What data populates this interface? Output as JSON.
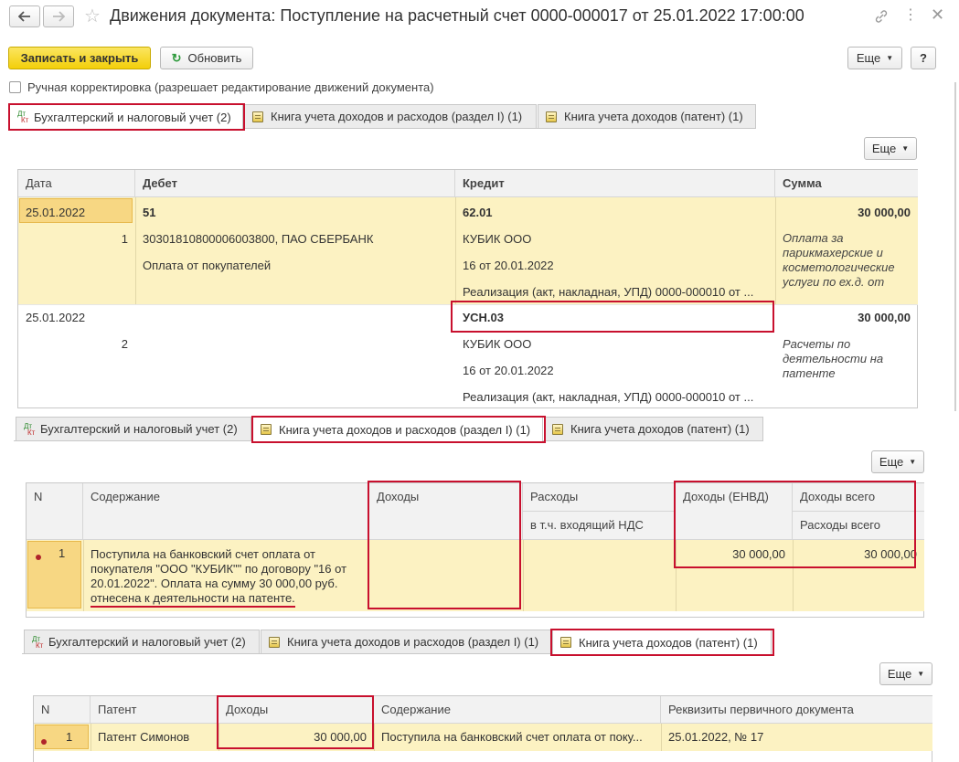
{
  "window": {
    "title": "Движения документа: Поступление на расчетный счет 0000-000017 от 25.01.2022 17:00:00"
  },
  "toolbar": {
    "save_close": "Записать и закрыть",
    "refresh": "Обновить",
    "more": "Еще",
    "help": "?"
  },
  "manual": {
    "label": "Ручная корректировка (разрешает редактирование движений документа)"
  },
  "tabs": [
    "Бухгалтерский и налоговый учет (2)",
    "Книга учета доходов и расходов (раздел I) (1)",
    "Книга учета доходов (патент) (1)"
  ],
  "icons": {
    "dtkt_top": "Дт",
    "dtkt_bottom": "Кт"
  },
  "more_label": "Еще",
  "panel1": {
    "headers": {
      "date": "Дата",
      "debit": "Дебет",
      "credit": "Кредит",
      "sum": "Сумма"
    },
    "rows": [
      {
        "date": "25.01.2022",
        "n": "1",
        "debit": "51",
        "credit": "62.01",
        "sum": "30 000,00",
        "debit_sub1": "30301810800006003800, ПАО СБЕРБАНК",
        "debit_sub2": "Оплата от покупателей",
        "credit_sub1": "КУБИК ООО",
        "credit_sub2": "16 от 20.01.2022",
        "credit_sub3": "Реализация (акт, накладная, УПД) 0000-000010 от ...",
        "content_1": "Оплата за",
        "content_2": "парикмахерские и",
        "content_3": "косметологические",
        "content_4": "услуги по ех.д.  от"
      },
      {
        "date": "25.01.2022",
        "n": "2",
        "debit": "",
        "credit": "УСН.03",
        "sum": "30 000,00",
        "credit_sub1": "КУБИК ООО",
        "credit_sub2": "16 от 20.01.2022",
        "credit_sub3": "Реализация (акт, накладная, УПД) 0000-000010 от ...",
        "content_1": "Расчеты по",
        "content_2": "деятельности на",
        "content_3": "патенте"
      }
    ]
  },
  "panel2": {
    "headers": {
      "n": "N",
      "content": "Содержание",
      "income": "Доходы",
      "expense": "Расходы",
      "expense_vat": "в т.ч. входящий НДС",
      "income_envd": "Доходы (ЕНВД)",
      "income_total": "Доходы всего",
      "expense_total": "Расходы всего"
    },
    "row": {
      "n": "1",
      "content_l1": "Поступила на банковский счет оплата от",
      "content_l2": "покупателя \"ООО \"КУБИК\"\" по договору \"16 от",
      "content_l3": "20.01.2022\". Оплата на сумму 30 000,00 руб.",
      "content_l4": "отнесена к деятельности на патенте.",
      "income_envd": "30 000,00",
      "income_total": "30 000,00"
    }
  },
  "panel3": {
    "headers": {
      "n": "N",
      "patent": "Патент",
      "income": "Доходы",
      "content": "Содержание",
      "doc": "Реквизиты первичного документа"
    },
    "row": {
      "n": "1",
      "patent": "Патент Симонов",
      "income": "30 000,00",
      "content": "Поступила на банковский счет оплата от поку...",
      "doc": "25.01.2022, № 17"
    }
  },
  "colors": {
    "accent_red": "#c8102e",
    "row_yellow": "#fcf2c2",
    "button_yellow": "#f3cf0a"
  }
}
